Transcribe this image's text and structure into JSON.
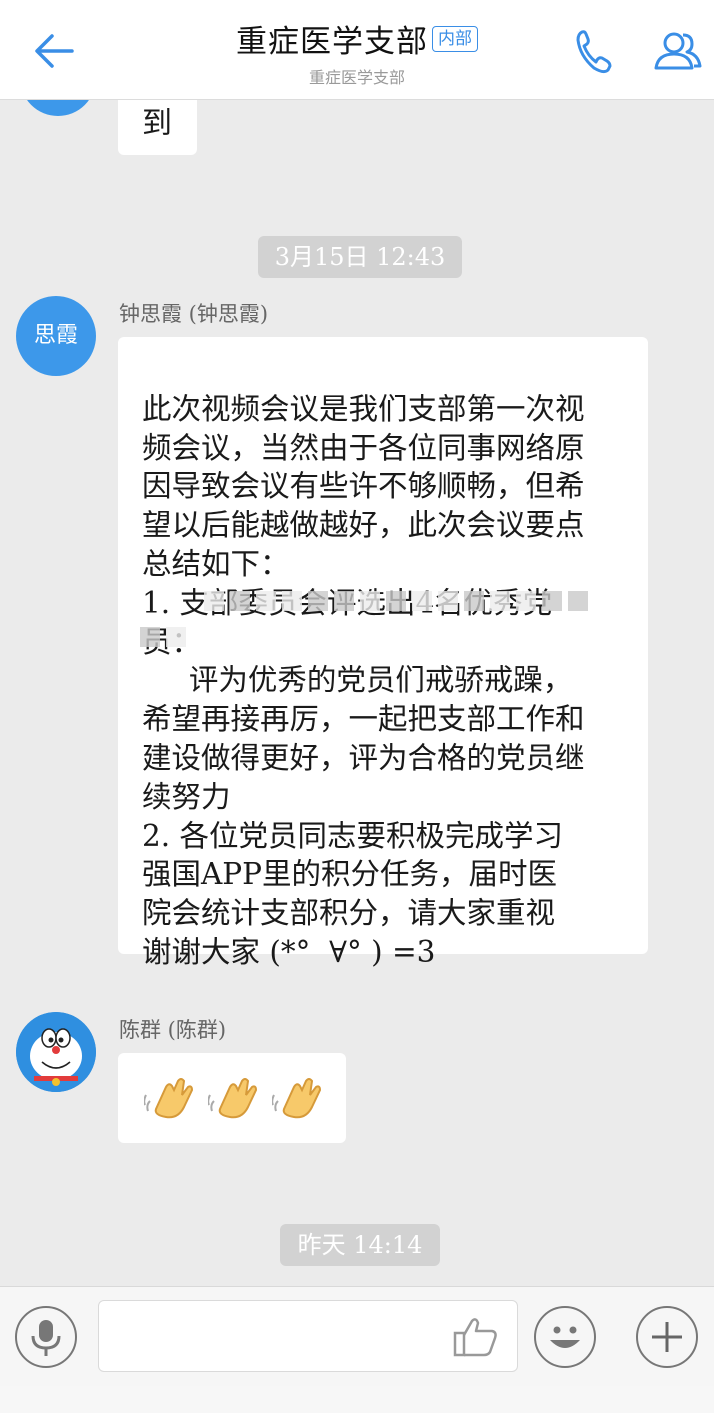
{
  "header": {
    "title": "重症医学支部",
    "badge": "内部",
    "subtitle": "重症医学支部"
  },
  "colors": {
    "accent": "#3a8ee6",
    "avatar": "#3d98ea",
    "background": "#ebebeb"
  },
  "icons": {
    "back": "arrow-left-icon",
    "phone": "phone-icon",
    "members": "group-members-icon",
    "voice": "microphone-icon",
    "like": "thumbs-up-icon",
    "emoji": "smiley-icon",
    "more": "plus-icon"
  },
  "messages": {
    "previous_partial": "到",
    "timestamp_1": "3月15日  12:43",
    "msg1": {
      "avatar_text": "思霞",
      "sender": "钟思霞 (钟思霞)",
      "lines": [
        "此次视频会议是我们支部第一次视",
        "频会议，当然由于各位同事网络原",
        "因导致会议有些许不够顺畅，但希",
        "望以后能越做越好，此次会议要点",
        "总结如下：",
        "1. 支部委员会评选出4名优秀党",
        "员：",
        "     评为优秀的党员们戒骄戒躁，",
        "希望再接再厉，一起把支部工作和",
        "建设做得更好，评为合格的党员继",
        "续努力",
        "2. 各位党员同志要积极完成学习",
        "强国APP里的积分任务，届时医",
        "院会统计支部积分，请大家重视",
        "谢谢大家 (*°  ∀° ) =3"
      ]
    },
    "msg2": {
      "sender": "陈群 (陈群)",
      "content": "👏👏👏"
    },
    "timestamp_2": "昨天  14:14"
  },
  "input": {
    "value": "",
    "placeholder": ""
  }
}
